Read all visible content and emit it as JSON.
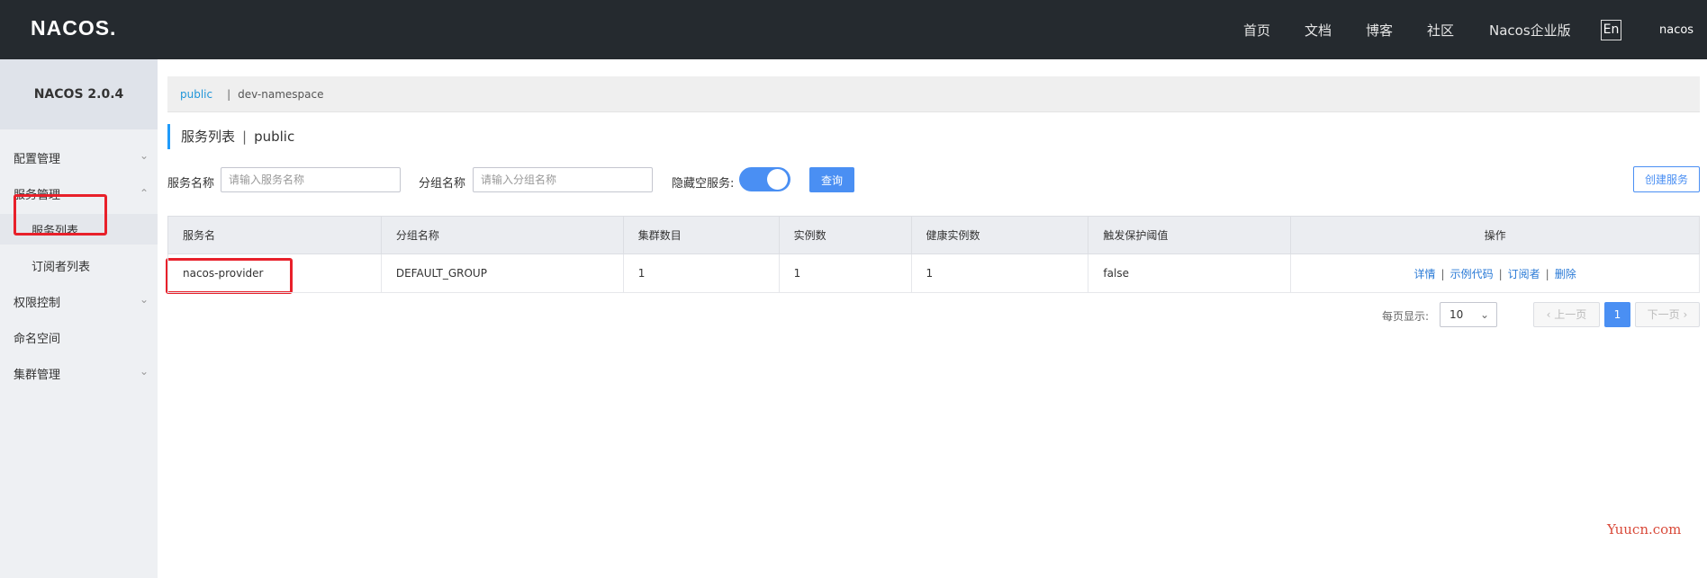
{
  "header": {
    "logo": "NACOS.",
    "nav": [
      "首页",
      "文档",
      "博客",
      "社区",
      "Nacos企业版"
    ],
    "lang_button": "En",
    "user": "nacos"
  },
  "sidebar": {
    "version": "NACOS 2.0.4",
    "items": [
      {
        "label": "配置管理"
      },
      {
        "label": "服务管理"
      },
      {
        "label": "服务列表"
      },
      {
        "label": "订阅者列表"
      },
      {
        "label": "权限控制"
      },
      {
        "label": "命名空间"
      },
      {
        "label": "集群管理"
      }
    ]
  },
  "namespace": {
    "active": "public",
    "separator": "|",
    "other": "dev-namespace"
  },
  "page": {
    "title": "服务列表",
    "divider": "|",
    "namespace": "public"
  },
  "filters": {
    "service_name_label": "服务名称",
    "service_name_placeholder": "请输入服务名称",
    "group_name_label": "分组名称",
    "group_name_placeholder": "请输入分组名称",
    "hide_empty_label": "隐藏空服务:",
    "hide_empty_on": true,
    "query_button": "查询",
    "create_button": "创建服务"
  },
  "table": {
    "columns": [
      "服务名",
      "分组名称",
      "集群数目",
      "实例数",
      "健康实例数",
      "触发保护阈值",
      "操作"
    ],
    "rows": [
      {
        "service": "nacos-provider",
        "group": "DEFAULT_GROUP",
        "clusters": "1",
        "instances": "1",
        "healthy": "1",
        "threshold": "false"
      }
    ],
    "ops": [
      "详情",
      "示例代码",
      "订阅者",
      "删除"
    ],
    "op_separator": "|"
  },
  "pagination": {
    "page_size_label": "每页显示:",
    "page_size": "10",
    "prev": "上一页",
    "current": "1",
    "next": "下一页"
  },
  "watermark": "Yuucn.com",
  "colors": {
    "accent": "#4a8ff3",
    "header_bg": "#252a2f",
    "highlight": "#e8202a"
  }
}
